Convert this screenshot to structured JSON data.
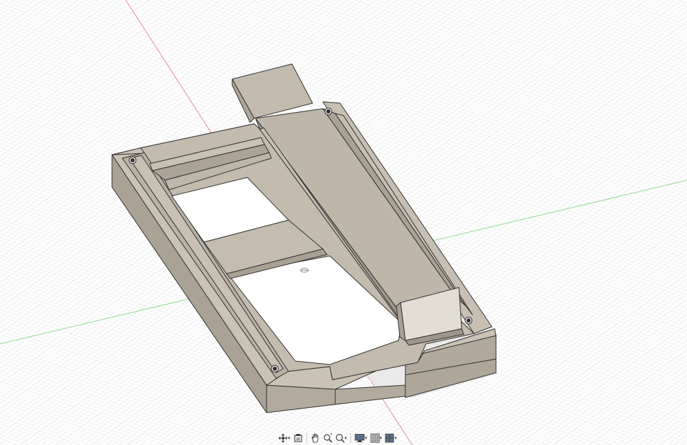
{
  "viewport": {
    "background": "#ffffff",
    "grid_minor_color": "#e3e3e3",
    "grid_major_color": "#d2d2d2",
    "x_axis_color": "#e07f7f",
    "y_axis_color": "#7fd27f",
    "model_face_color": "#c4bdb0",
    "model_side_color": "#aca497",
    "model_edge_color": "#2f2f2f"
  },
  "navigation_bar": {
    "tools": [
      {
        "icon": "orbit-icon",
        "has_dropdown": true
      },
      {
        "icon": "look-at-icon",
        "has_dropdown": false
      },
      {
        "icon": "pan-hand-icon",
        "has_dropdown": false
      },
      {
        "icon": "zoom-icon",
        "has_dropdown": false
      },
      {
        "icon": "fit-zoom-icon",
        "has_dropdown": true
      },
      {
        "icon": "display-settings-icon",
        "has_dropdown": true
      },
      {
        "icon": "grid-snaps-icon",
        "has_dropdown": true
      },
      {
        "icon": "viewports-icon",
        "has_dropdown": true
      }
    ]
  }
}
